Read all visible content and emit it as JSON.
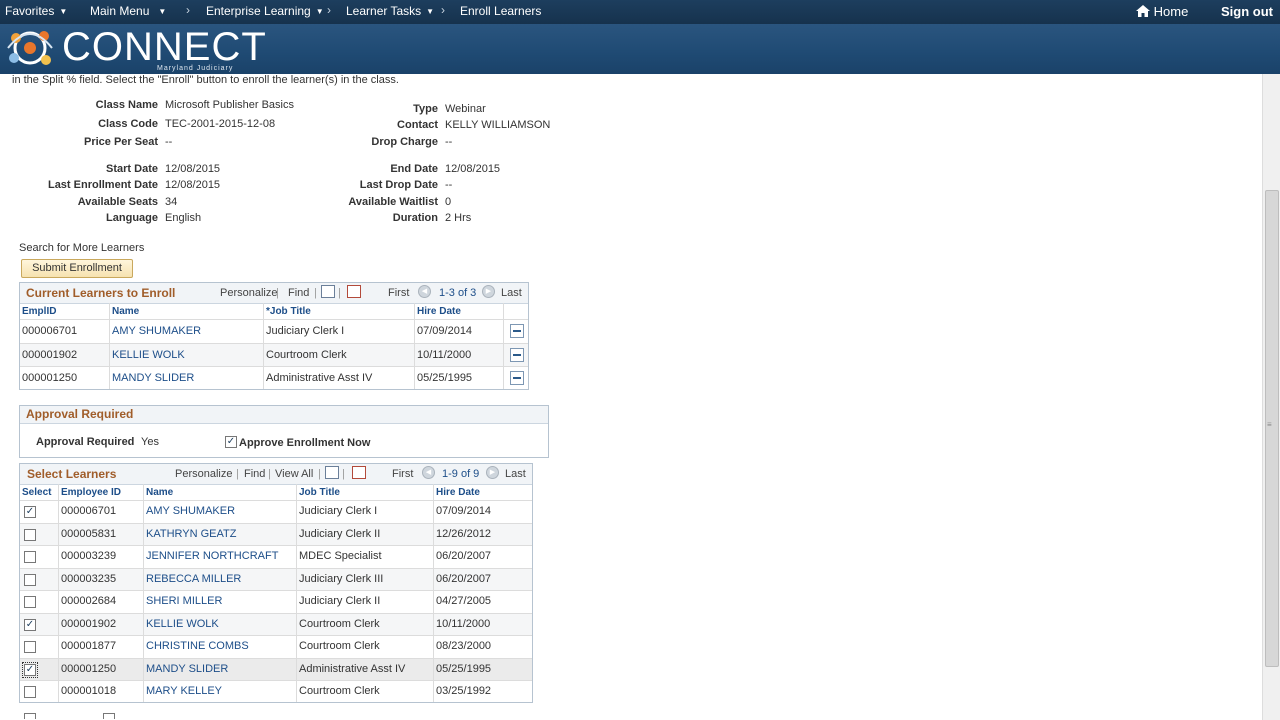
{
  "nav": {
    "favorites": "Favorites",
    "main_menu": "Main Menu",
    "crumbs": [
      "Enterprise Learning",
      "Learner Tasks",
      "Enroll Learners"
    ],
    "home": "Home",
    "sign_out": "Sign out"
  },
  "banner": {
    "logo": "CONNECT",
    "sub": "Maryland Judiciary"
  },
  "instructions": "in the Split % field. Select the \"Enroll\" button to enroll the learner(s) in the class.",
  "class_info": {
    "class_name_label": "Class Name",
    "class_name": "Microsoft Publisher Basics",
    "class_code_label": "Class Code",
    "class_code": "TEC-2001-2015-12-08",
    "price_label": "Price Per Seat",
    "price": "--",
    "start_label": "Start Date",
    "start": "12/08/2015",
    "last_enroll_label": "Last Enrollment Date",
    "last_enroll": "12/08/2015",
    "seats_label": "Available Seats",
    "seats": "34",
    "language_label": "Language",
    "language": "English",
    "type_label": "Type",
    "type": "Webinar",
    "contact_label": "Contact",
    "contact": "KELLY WILLIAMSON",
    "drop_charge_label": "Drop Charge",
    "drop_charge": "--",
    "end_label": "End Date",
    "end": "12/08/2015",
    "last_drop_label": "Last Drop Date",
    "last_drop": "--",
    "waitlist_label": "Available Waitlist",
    "waitlist": "0",
    "duration_label": "Duration",
    "duration": "2 Hrs"
  },
  "search_link": "Search for More Learners",
  "submit_button": "Submit Enrollment",
  "current": {
    "title": "Current Learners to Enroll",
    "personalize": "Personalize",
    "find": "Find",
    "first": "First",
    "count": "1-3 of 3",
    "last": "Last",
    "columns": [
      "EmplID",
      "Name",
      "*Job Title",
      "Hire Date"
    ],
    "rows": [
      {
        "id": "000006701",
        "name": "AMY SHUMAKER",
        "job": "Judiciary Clerk I",
        "hire": "07/09/2014"
      },
      {
        "id": "000001902",
        "name": "KELLIE WOLK",
        "job": "Courtroom Clerk",
        "hire": "10/11/2000"
      },
      {
        "id": "000001250",
        "name": "MANDY SLIDER",
        "job": "Administrative Asst IV",
        "hire": "05/25/1995"
      }
    ]
  },
  "approval": {
    "title": "Approval Required",
    "label": "Approval Required",
    "value": "Yes",
    "approve_now": "Approve Enrollment Now"
  },
  "select": {
    "title": "Select Learners",
    "personalize": "Personalize",
    "find": "Find",
    "view_all": "View All",
    "first": "First",
    "count": "1-9 of 9",
    "last": "Last",
    "columns": [
      "Select",
      "Employee ID",
      "Name",
      "Job Title",
      "Hire Date"
    ],
    "rows": [
      {
        "checked": true,
        "id": "000006701",
        "name": "AMY SHUMAKER",
        "job": "Judiciary Clerk I",
        "hire": "07/09/2014"
      },
      {
        "checked": false,
        "id": "000005831",
        "name": "KATHRYN GEATZ",
        "job": "Judiciary Clerk II",
        "hire": "12/26/2012"
      },
      {
        "checked": false,
        "id": "000003239",
        "name": "JENNIFER NORTHCRAFT",
        "job": "MDEC Specialist",
        "hire": "06/20/2007"
      },
      {
        "checked": false,
        "id": "000003235",
        "name": "REBECCA MILLER",
        "job": "Judiciary Clerk III",
        "hire": "06/20/2007"
      },
      {
        "checked": false,
        "id": "000002684",
        "name": "SHERI MILLER",
        "job": "Judiciary Clerk II",
        "hire": "04/27/2005"
      },
      {
        "checked": true,
        "id": "000001902",
        "name": "KELLIE WOLK",
        "job": "Courtroom Clerk",
        "hire": "10/11/2000"
      },
      {
        "checked": false,
        "id": "000001877",
        "name": "CHRISTINE COMBS",
        "job": "Courtroom Clerk",
        "hire": "08/23/2000"
      },
      {
        "checked": true,
        "id": "000001250",
        "name": "MANDY SLIDER",
        "job": "Administrative Asst IV",
        "hire": "05/25/1995"
      },
      {
        "checked": false,
        "id": "000001018",
        "name": "MARY KELLEY",
        "job": "Courtroom Clerk",
        "hire": "03/25/1992"
      }
    ]
  }
}
